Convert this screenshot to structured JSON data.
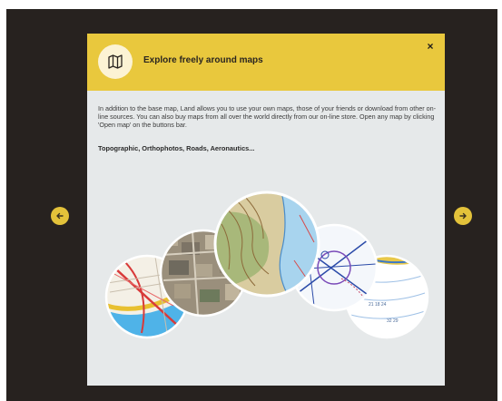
{
  "modal": {
    "title": "Explore freely around maps",
    "description": "In addition to the base map, Land allows you to use your own maps, those of your friends or download from other on-line sources. You can also buy maps from all over the world directly from our on-line store. Open any map by clicking 'Open map' on the buttons bar.",
    "map_types": "Topographic, Orthophotos, Roads, Aeronautics...",
    "close_label": "×",
    "icon": "map-icon"
  },
  "navigation": {
    "prev_icon": "arrow-left-icon",
    "next_icon": "arrow-right-icon"
  },
  "map_previews": [
    "road-map",
    "orthophoto-map",
    "topographic-map",
    "aeronautical-map",
    "nautical-map"
  ],
  "colors": {
    "backdrop": "#27221f",
    "header": "#e9c83d",
    "modal_body": "#e6e9ea",
    "nav_button": "#e3c23a"
  }
}
